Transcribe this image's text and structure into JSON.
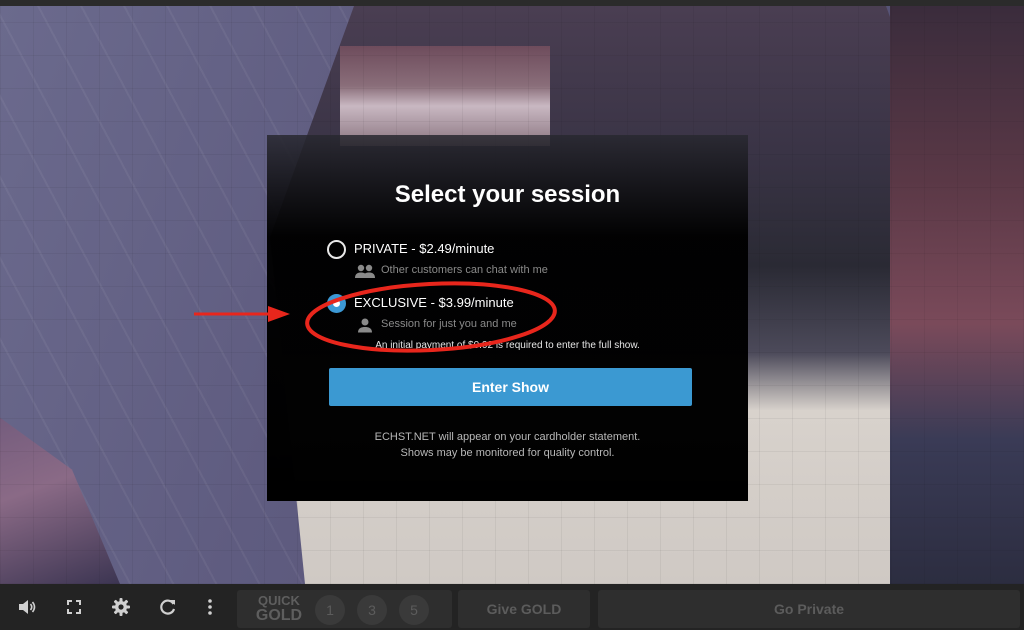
{
  "modal": {
    "title": "Select your session",
    "options": [
      {
        "label": "PRIVATE - $2.49/minute",
        "description": "Other customers can chat with me",
        "icon": "group-icon",
        "selected": false
      },
      {
        "label": "EXCLUSIVE - $3.99/minute",
        "description": "Session for just you and me",
        "icon": "person-icon",
        "selected": true
      }
    ],
    "payment_note": "An initial payment of $0.02 is required to enter the full show.",
    "enter_button": "Enter Show",
    "footnote_line1": "ECHST.NET will appear on your cardholder statement.",
    "footnote_line2": "Shows may be monitored for quality control."
  },
  "annotation": {
    "color": "#e8261c",
    "arrow": "red-arrow",
    "highlight": "red-ellipse"
  },
  "controls": {
    "icons": [
      "volume-icon",
      "fullscreen-icon",
      "gear-icon",
      "refresh-icon",
      "more-vertical-icon"
    ],
    "quick_gold": {
      "line1": "QUICK",
      "line2": "GOLD",
      "amounts": [
        "1",
        "3",
        "5"
      ]
    },
    "give_gold": "Give GOLD",
    "go_private": "Go Private"
  },
  "colors": {
    "accent": "#3b99d2",
    "modal_bg": "#000000",
    "bar_bg": "#232323",
    "disabled_text": "#5c5c5c"
  }
}
